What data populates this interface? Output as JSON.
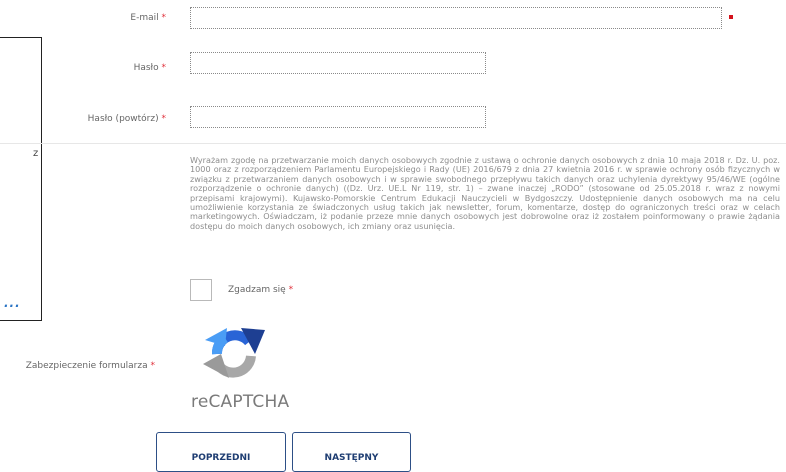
{
  "form": {
    "email": {
      "label": "E-mail",
      "required_mark": "*",
      "value": ""
    },
    "password": {
      "label": "Hasło",
      "required_mark": "*",
      "value": ""
    },
    "password_repeat": {
      "label": "Hasło (powtórz)",
      "required_mark": "*",
      "value": ""
    }
  },
  "side_panel": {
    "letter": "z",
    "more_link": "..."
  },
  "consent": {
    "text": "Wyrażam zgodę na przetwarzanie moich danych osobowych zgodnie z ustawą o ochronie danych osobowych z dnia 10 maja 2018 r. Dz. U. poz. 1000 oraz z rozporządzeniem Parlamentu Europejskiego i Rady (UE) 2016/679 z dnia 27 kwietnia 2016 r. w sprawie ochrony osób fizycznych w związku z przetwarzaniem danych osobowych i w sprawie swobodnego przepływu takich danych oraz uchylenia dyrektywy 95/46/WE (ogólne rozporządzenie o ochronie danych) ((Dz. Urz. UE.L Nr 119, str. 1) – zwane inaczej „RODO” (stosowane od 25.05.2018 r. wraz z nowymi przepisami krajowymi). Kujawsko-Pomorskie Centrum Edukacji Nauczycieli w Bydgoszczy. Udostępnienie danych osobowych ma na celu umożliwienie korzystania ze świadczonych usług takich jak newsletter, forum, komentarze, dostęp do ograniczonych treści oraz w celach marketingowych. Oświadczam, iż podanie przeze mnie danych osobowych jest dobrowolne oraz iż zostałem poinformowany o prawie żądania dostępu do moich danych osobowych, ich zmiany oraz usunięcia.",
    "checkbox_label": "Zgadzam się",
    "required_mark": "*",
    "checked": false
  },
  "captcha": {
    "label": "Zabezpieczenie formularza",
    "required_mark": "*",
    "brand_text": "reCAPTCHA",
    "icon": "recaptcha-icon"
  },
  "buttons": {
    "prev": "POPRZEDNI",
    "next": "NASTĘPNY"
  },
  "colors": {
    "required": "#e0303a",
    "button_border": "#2d4f86",
    "link": "#2a74c4"
  }
}
